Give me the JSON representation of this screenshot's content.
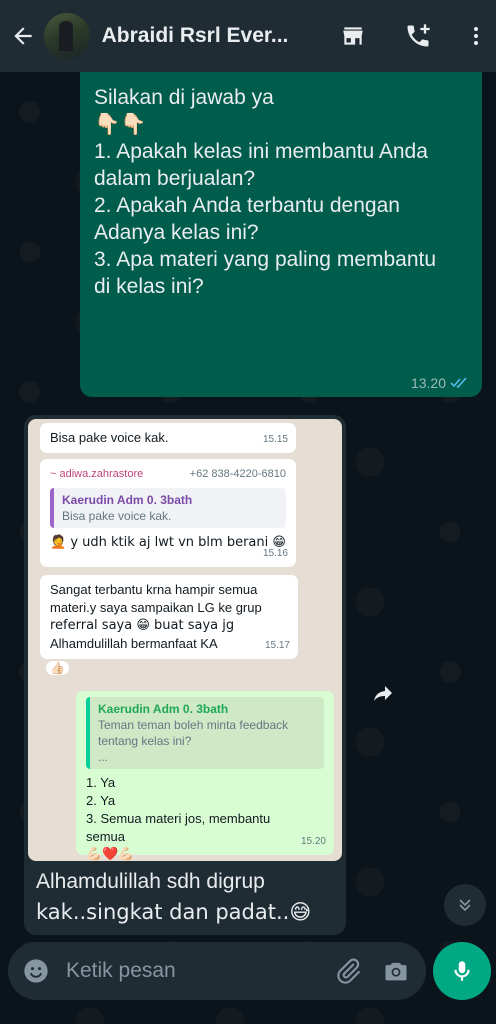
{
  "header": {
    "contact_name": "Abraidi Rsrl Ever..."
  },
  "outgoing_message": {
    "lines": [
      "Silakan di jawab ya",
      "👇🏻👇🏻",
      "",
      "1. Apakah kelas ini membantu Anda",
      "dalam berjualan?",
      "",
      "2. Apakah Anda terbantu dengan",
      "Adanya kelas ini?",
      "",
      "3. Apa materi yang paling membantu",
      "di kelas ini?"
    ],
    "time": "13.20",
    "status": "read"
  },
  "screenshot_messages": {
    "msg1": {
      "text": "Bisa pake voice kak.",
      "time": "15.15"
    },
    "msg2": {
      "sender": "~ adiwa.zahrastore",
      "phone": "+62 838-4220-6810",
      "quote_name": "Kaerudin Adm 0. 3bath",
      "quote_text": "Bisa pake voice kak.",
      "text": "🤦 y udh ktik aj lwt vn blm berani 😁",
      "time": "15.16"
    },
    "msg3": {
      "lines": [
        "Sangat terbantu krna hampir semua",
        "materi.y saya sampaikan LG ke grup",
        "referral saya 😁 buat saya jg",
        "Alhamdulillah bermanfaat KA"
      ],
      "time": "15.17",
      "reaction": "👍🏻"
    },
    "msg4": {
      "quote_name": "Kaerudin Adm 0. 3bath",
      "quote_lines": [
        "Teman teman boleh minta feedback",
        "tentang kelas ini?",
        "..."
      ],
      "lines": [
        "1. Ya",
        "2. Ya",
        "3. Semua materi jos, membantu",
        "semua"
      ],
      "reaction": "💪🏻❤️💪🏻",
      "time": "15.20"
    }
  },
  "incoming_caption": {
    "line1": "Alhamdulillah sdh digrup",
    "line2": "kak..singkat dan padat..😅"
  },
  "input": {
    "placeholder": "Ketik pesan"
  },
  "icons": {
    "back": "arrow-left-icon",
    "shop": "shop-icon",
    "add_call": "call-add-icon",
    "menu": "more-vert-icon",
    "forward": "forward-icon",
    "scroll": "chevron-double-down-icon",
    "emoji": "emoji-icon",
    "attach": "paperclip-icon",
    "camera": "camera-icon",
    "mic": "mic-icon"
  },
  "colors": {
    "header": "#202c33",
    "outgoing_bubble": "#005c4b",
    "incoming_bubble": "#202c33",
    "accent": "#00a884",
    "read_ticks": "#53bdeb"
  }
}
